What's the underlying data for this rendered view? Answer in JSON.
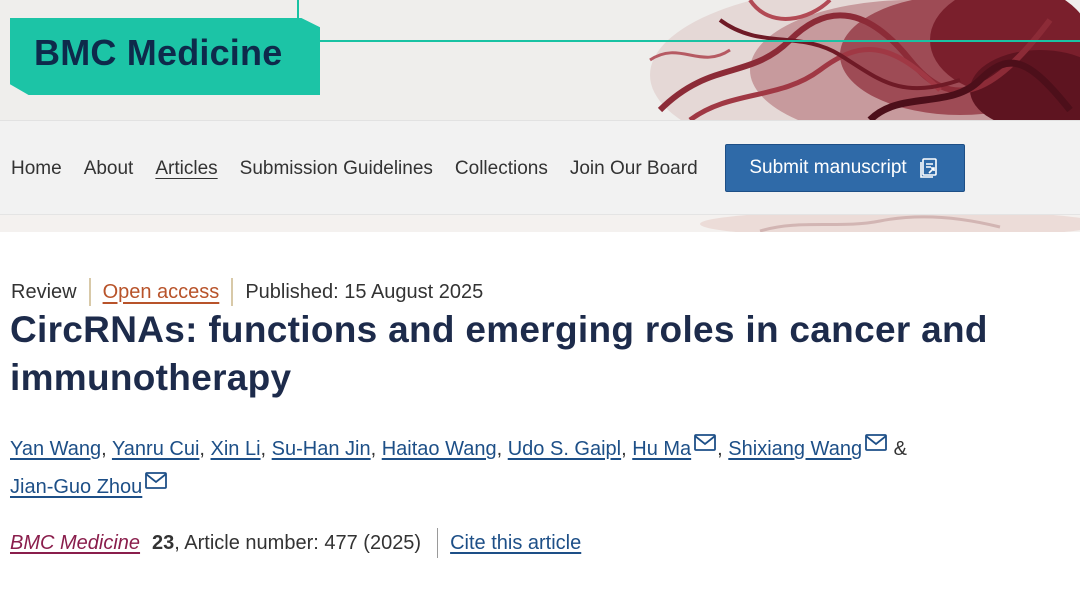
{
  "journal": {
    "name": "BMC Medicine"
  },
  "nav": {
    "items": [
      {
        "label": "Home",
        "active": false
      },
      {
        "label": "About",
        "active": false
      },
      {
        "label": "Articles",
        "active": true
      },
      {
        "label": "Submission Guidelines",
        "active": false
      },
      {
        "label": "Collections",
        "active": false
      },
      {
        "label": "Join Our Board",
        "active": false
      }
    ],
    "submit_label": "Submit manuscript"
  },
  "article": {
    "type": "Review",
    "access": "Open access",
    "published": "Published: 15 August 2025",
    "title": "CircRNAs: functions and emerging roles in cancer and immunotherapy",
    "authors": [
      {
        "name": "Yan Wang",
        "mail": false,
        "sep": ", "
      },
      {
        "name": "Yanru Cui",
        "mail": false,
        "sep": ", "
      },
      {
        "name": "Xin Li",
        "mail": false,
        "sep": ", "
      },
      {
        "name": "Su-Han Jin",
        "mail": false,
        "sep": ", "
      },
      {
        "name": "Haitao Wang",
        "mail": false,
        "sep": ", "
      },
      {
        "name": "Udo S. Gaipl",
        "mail": false,
        "sep": ", "
      },
      {
        "name": "Hu Ma",
        "mail": true,
        "sep": ", "
      },
      {
        "name": "Shixiang Wang",
        "mail": true,
        "sep": " & "
      },
      {
        "name": "Jian-Guo Zhou",
        "mail": true,
        "sep": ""
      }
    ],
    "citation": {
      "journal": "BMC Medicine",
      "volume": "23",
      "article_number": ", Article number: 477 (2025)",
      "cite_label": "Cite this article"
    }
  },
  "colors": {
    "brand_teal": "#1cc4a6",
    "navy": "#0e2a4b",
    "button_blue": "#2f6aa8",
    "link_blue": "#1d4f87",
    "open_access_orange": "#b8532a",
    "journal_maroon": "#8a1e4c"
  },
  "icons": {
    "submit": "external-form-icon",
    "mail": "envelope-icon"
  }
}
